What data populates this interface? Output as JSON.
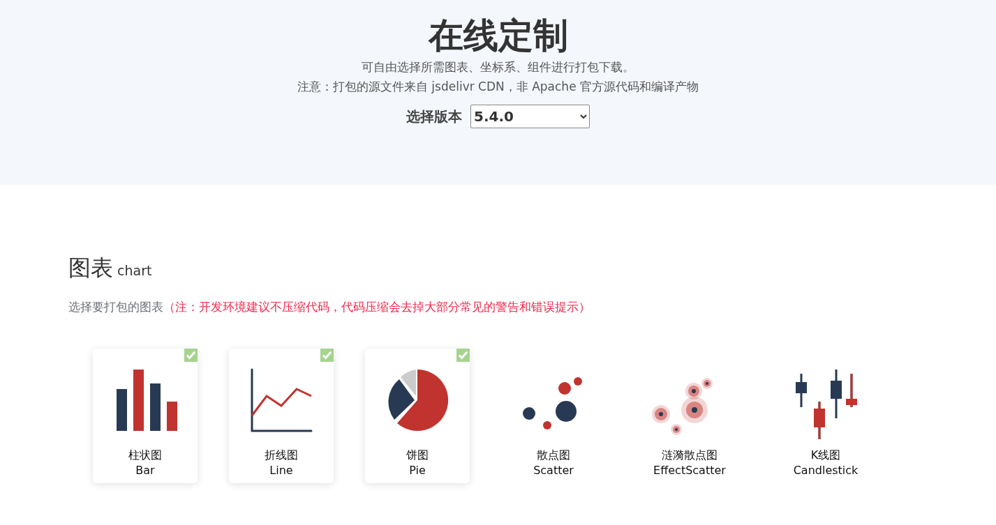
{
  "header": {
    "title": "在线定制",
    "description": "可自由选择所需图表、坐标系、组件进行打包下载。",
    "notice": "注意：打包的源文件来自 jsdelivr CDN，非 Apache 官方源代码和编译产物",
    "version_label": "选择版本",
    "version_value": "5.4.0"
  },
  "section": {
    "title": "图表",
    "subtitle": "chart",
    "hint": "选择要打包的图表",
    "warning": "（注：开发环境建议不压缩代码，代码压缩会去掉大部分常见的警告和错误提示）",
    "items": [
      {
        "kind": "bar",
        "name": "柱状图",
        "name_en": "Bar",
        "checked": true
      },
      {
        "kind": "line",
        "name": "折线图",
        "name_en": "Line",
        "checked": true
      },
      {
        "kind": "pie",
        "name": "饼图",
        "name_en": "Pie",
        "checked": true
      },
      {
        "kind": "scatter",
        "name": "散点图",
        "name_en": "Scatter",
        "checked": false
      },
      {
        "kind": "effectscatter",
        "name": "涟漪散点图",
        "name_en": "EffectScatter",
        "checked": false
      },
      {
        "kind": "candlestick",
        "name": "K线图",
        "name_en": "Candlestick",
        "checked": false
      }
    ]
  }
}
